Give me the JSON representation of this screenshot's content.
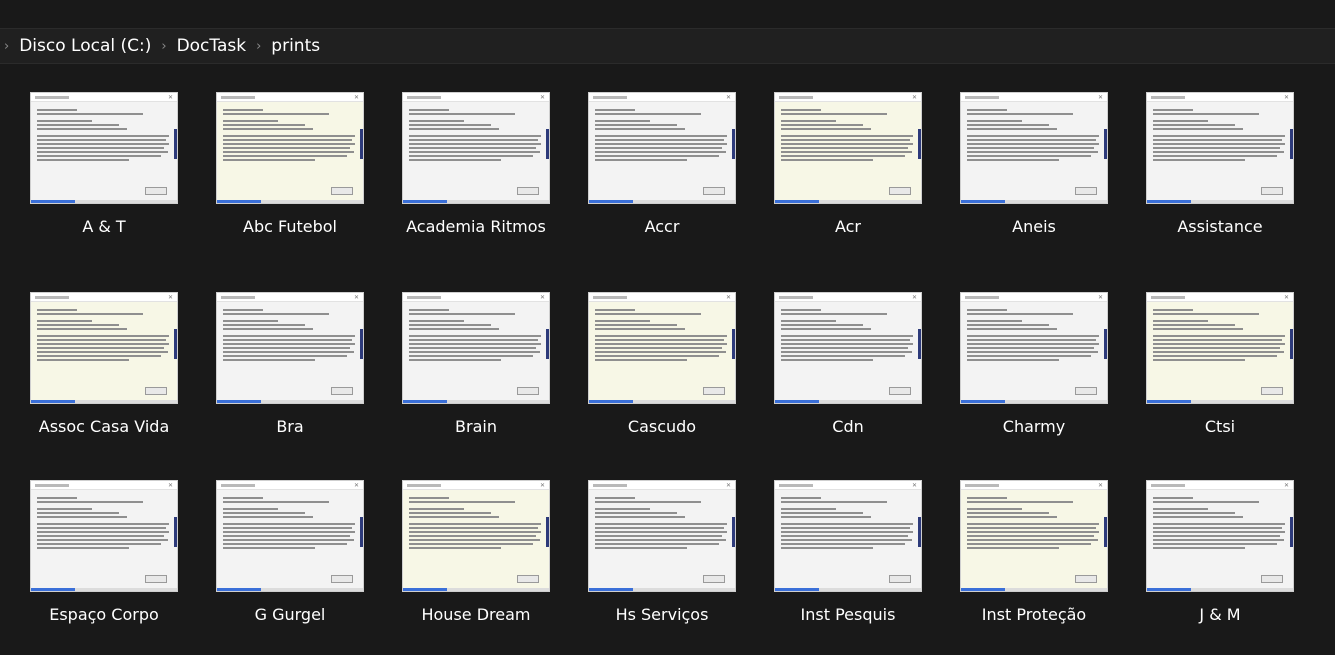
{
  "breadcrumb": {
    "items": [
      "Disco Local (C:)",
      "DocTask",
      "prints"
    ]
  },
  "icons": {
    "chevron": "›"
  },
  "files": [
    {
      "name": "A & T"
    },
    {
      "name": "Abc Futebol"
    },
    {
      "name": "Academia Ritmos"
    },
    {
      "name": "Accr"
    },
    {
      "name": "Acr"
    },
    {
      "name": "Aneis"
    },
    {
      "name": "Assistance"
    },
    {
      "name": "Assoc Casa Vida"
    },
    {
      "name": "Bra"
    },
    {
      "name": "Brain"
    },
    {
      "name": "Cascudo"
    },
    {
      "name": "Cdn"
    },
    {
      "name": "Charmy"
    },
    {
      "name": "Ctsi"
    },
    {
      "name": "Espaço Corpo"
    },
    {
      "name": "G Gurgel"
    },
    {
      "name": "House Dream"
    },
    {
      "name": "Hs Serviços"
    },
    {
      "name": "Inst Pesquis"
    },
    {
      "name": "Inst Proteção"
    },
    {
      "name": "J & M"
    }
  ],
  "colors": {
    "background": "#191919",
    "address_bar": "#202020",
    "text": "#ffffff",
    "chevron": "#8a8a8a"
  }
}
